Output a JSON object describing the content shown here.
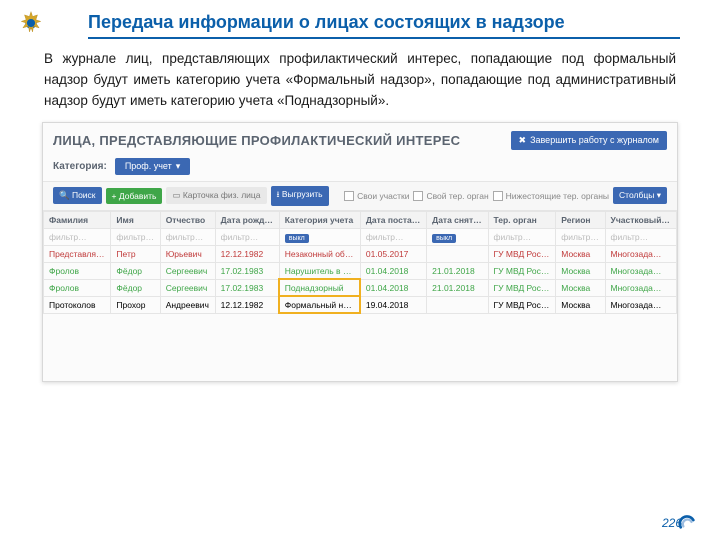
{
  "slide": {
    "title": "Передача информации о лицах состоящих в надзоре",
    "paragraph": "В журнале лиц, представляющих профилактический интерес, попадающие под формальный надзор будут иметь категорию учета «Формальный надзор»,  попадающие под административный надзор будут иметь категорию          учета «Поднадзорный».",
    "page_number": "226"
  },
  "app": {
    "window_title": "ЛИЦА, ПРЕДСТАВЛЯЮЩИЕ ПРОФИЛАКТИЧЕСКИЙ ИНТЕРЕС",
    "close_journal_label": "Завершить работу с журналом",
    "category_label": "Категория:",
    "category_value": "Проф. учет",
    "buttons": {
      "search": "Поиск",
      "add": "Добавить",
      "card": "Карточка физ. лица",
      "export": "Выгрузить"
    },
    "checkboxes": {
      "own_areas": "Свои участки",
      "own_org": "Свой тер. орган",
      "sub_orgs": "Нижестоящие тер. органы"
    },
    "columns_btn": "Столбцы",
    "columns": [
      "Фамилия",
      "Имя",
      "Отчество",
      "Дата рожд…",
      "Категория учета",
      "Дата поста…",
      "Дата снят…",
      "Тер. орган",
      "Регион",
      "Участковый…"
    ],
    "filter_placeholder": "фильтр…",
    "toggle_label": "выкл",
    "rows": [
      {
        "class": "row-red",
        "fam": "Представля…",
        "name": "Петр",
        "patr": "Юрьевич",
        "dob": "12.12.1982",
        "cat": "Незаконный оборот и потребление наркотиков",
        "post": "01.05.2017",
        "snyat": "",
        "org": "ГУ МВД Рос…",
        "region": "Москва",
        "uch": "Многозада…",
        "highlight": false
      },
      {
        "class": "row-green",
        "fam": "Фролов",
        "name": "Фёдор",
        "patr": "Сергеевич",
        "dob": "17.02.1983",
        "cat": "Нарушитель в сфере семейно-бытовых отн…",
        "post": "01.04.2018",
        "snyat": "21.01.2018",
        "org": "ГУ МВД Рос…",
        "region": "Москва",
        "uch": "Многозада…",
        "highlight": false
      },
      {
        "class": "row-green",
        "fam": "Фролов",
        "name": "Фёдор",
        "patr": "Сергеевич",
        "dob": "17.02.1983",
        "cat": "Поднадзорный",
        "post": "01.04.2018",
        "snyat": "21.01.2018",
        "org": "ГУ МВД Рос…",
        "region": "Москва",
        "uch": "Многозада…",
        "highlight": true
      },
      {
        "class": "",
        "fam": "Протоколов",
        "name": "Прохор",
        "patr": "Андреевич",
        "dob": "12.12.1982",
        "cat": "Формальный надзор",
        "post": "19.04.2018",
        "snyat": "",
        "org": "ГУ МВД Рос…",
        "region": "Москва",
        "uch": "Многозада…",
        "highlight": true
      }
    ]
  }
}
